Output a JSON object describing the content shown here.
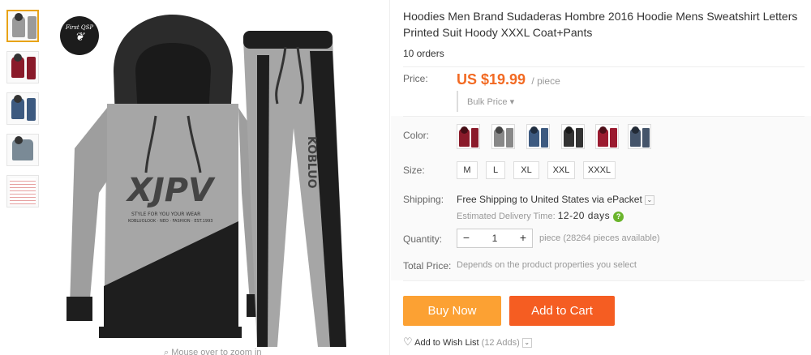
{
  "product": {
    "title": "Hoodies Men Brand Sudaderas Hombre 2016 Hoodie Mens Sweatshirt Letters Printed Suit Hoody XXXL Coat+Pants",
    "orders": "10 orders"
  },
  "image": {
    "logo_text": "First QSP",
    "zoom_hint": "Mouse over to zoom in",
    "thumbnail_count": 5,
    "print_text": "XJPV",
    "pants_text": "KOBLUO"
  },
  "price": {
    "label": "Price:",
    "amount": "US $19.99",
    "unit": "/ piece",
    "bulk": "Bulk Price"
  },
  "color": {
    "label": "Color:",
    "swatches": [
      "#8a1a2a",
      "#2a2a2a",
      "#3d5a80",
      "#1a1a1a",
      "#9b1b30",
      "#44546a"
    ]
  },
  "size": {
    "label": "Size:",
    "options": [
      "M",
      "L",
      "XL",
      "XXL",
      "XXXL"
    ]
  },
  "shipping": {
    "label": "Shipping:",
    "text": "Free Shipping to United States via ePacket",
    "estimate_label": "Estimated Delivery Time:",
    "estimate_days": "12-20 days"
  },
  "quantity": {
    "label": "Quantity:",
    "minus": "−",
    "plus": "+",
    "value": "1",
    "available": "piece (28264 pieces available)"
  },
  "total": {
    "label": "Total Price:",
    "text": "Depends on the product properties you select"
  },
  "actions": {
    "buy_now": "Buy Now",
    "add_to_cart": "Add to Cart",
    "wishlist": "Add to Wish List",
    "wishlist_count": "(12 Adds)"
  },
  "colors": {
    "price": "#f26a23",
    "buy_now": "#fca133",
    "add_to_cart": "#f55d22",
    "active_thumb_border": "#e8a317"
  }
}
